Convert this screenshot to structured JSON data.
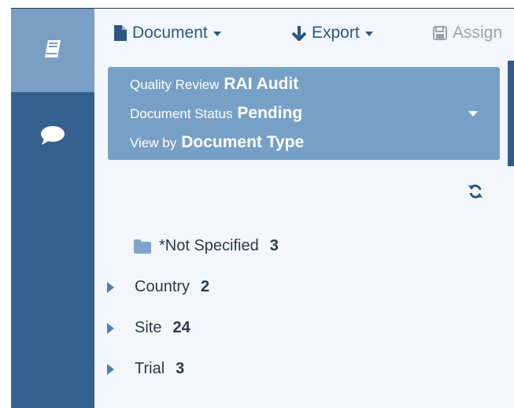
{
  "toolbar": {
    "document_label": "Document",
    "export_label": "Export",
    "assign_label": "Assign"
  },
  "filter_panel": {
    "quality_review_label": "Quality Review",
    "quality_review_value": "RAI Audit",
    "document_status_label": "Document Status",
    "document_status_value": "Pending",
    "view_by_label": "View by",
    "view_by_value": "Document Type"
  },
  "tree": [
    {
      "label": "*Not Specified",
      "count": "3",
      "kind": "folder"
    },
    {
      "label": "Country",
      "count": "2",
      "kind": "expandable"
    },
    {
      "label": "Site",
      "count": "24",
      "kind": "expandable"
    },
    {
      "label": "Trial",
      "count": "3",
      "kind": "expandable"
    }
  ],
  "colors": {
    "rail": "#35618f",
    "rail_active": "#7a9ec4",
    "panel": "#77a0c6",
    "accent": "#2c5784"
  },
  "icons": {
    "rail_top": "book-icon",
    "rail_second": "chat-bubble-icon",
    "toolbar_document": "file-icon",
    "toolbar_export": "arrow-down-icon",
    "toolbar_assign": "floppy-disk-icon",
    "refresh": "refresh-icon",
    "folder": "folder-icon",
    "expand": "caret-right-icon"
  }
}
